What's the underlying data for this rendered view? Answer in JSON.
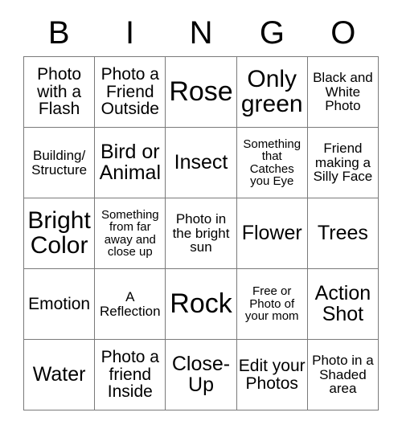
{
  "card": {
    "header_letters": [
      "B",
      "I",
      "N",
      "G",
      "O"
    ],
    "rows": [
      [
        {
          "text": "Photo with a Flash",
          "size": "sm"
        },
        {
          "text": "Photo a Friend Outside",
          "size": "sm"
        },
        {
          "text": "Rose",
          "size": "xl"
        },
        {
          "text": "Only green",
          "size": "lg"
        },
        {
          "text": "Black and White Photo",
          "size": "xs"
        }
      ],
      [
        {
          "text": "Building/ Structure",
          "size": "xs"
        },
        {
          "text": "Bird or Animal",
          "size": "md"
        },
        {
          "text": "Insect",
          "size": "md"
        },
        {
          "text": "Something that Catches you Eye",
          "size": "xxs"
        },
        {
          "text": "Friend making a Silly Face",
          "size": "xs"
        }
      ],
      [
        {
          "text": "Bright Color",
          "size": "lg"
        },
        {
          "text": "Something from far away and close up",
          "size": "xxs"
        },
        {
          "text": "Photo in the bright sun",
          "size": "xs"
        },
        {
          "text": "Flower",
          "size": "md"
        },
        {
          "text": "Trees",
          "size": "md"
        }
      ],
      [
        {
          "text": "Emotion",
          "size": "sm"
        },
        {
          "text": "A Reflection",
          "size": "xs"
        },
        {
          "text": "Rock",
          "size": "xl"
        },
        {
          "text": "Free or Photo of your mom",
          "size": "xxs"
        },
        {
          "text": "Action Shot",
          "size": "md"
        }
      ],
      [
        {
          "text": "Water",
          "size": "md"
        },
        {
          "text": "Photo a friend Inside",
          "size": "sm"
        },
        {
          "text": "Close-Up",
          "size": "md"
        },
        {
          "text": "Edit your Photos",
          "size": "sm"
        },
        {
          "text": "Photo in a Shaded area",
          "size": "xs"
        }
      ]
    ]
  }
}
